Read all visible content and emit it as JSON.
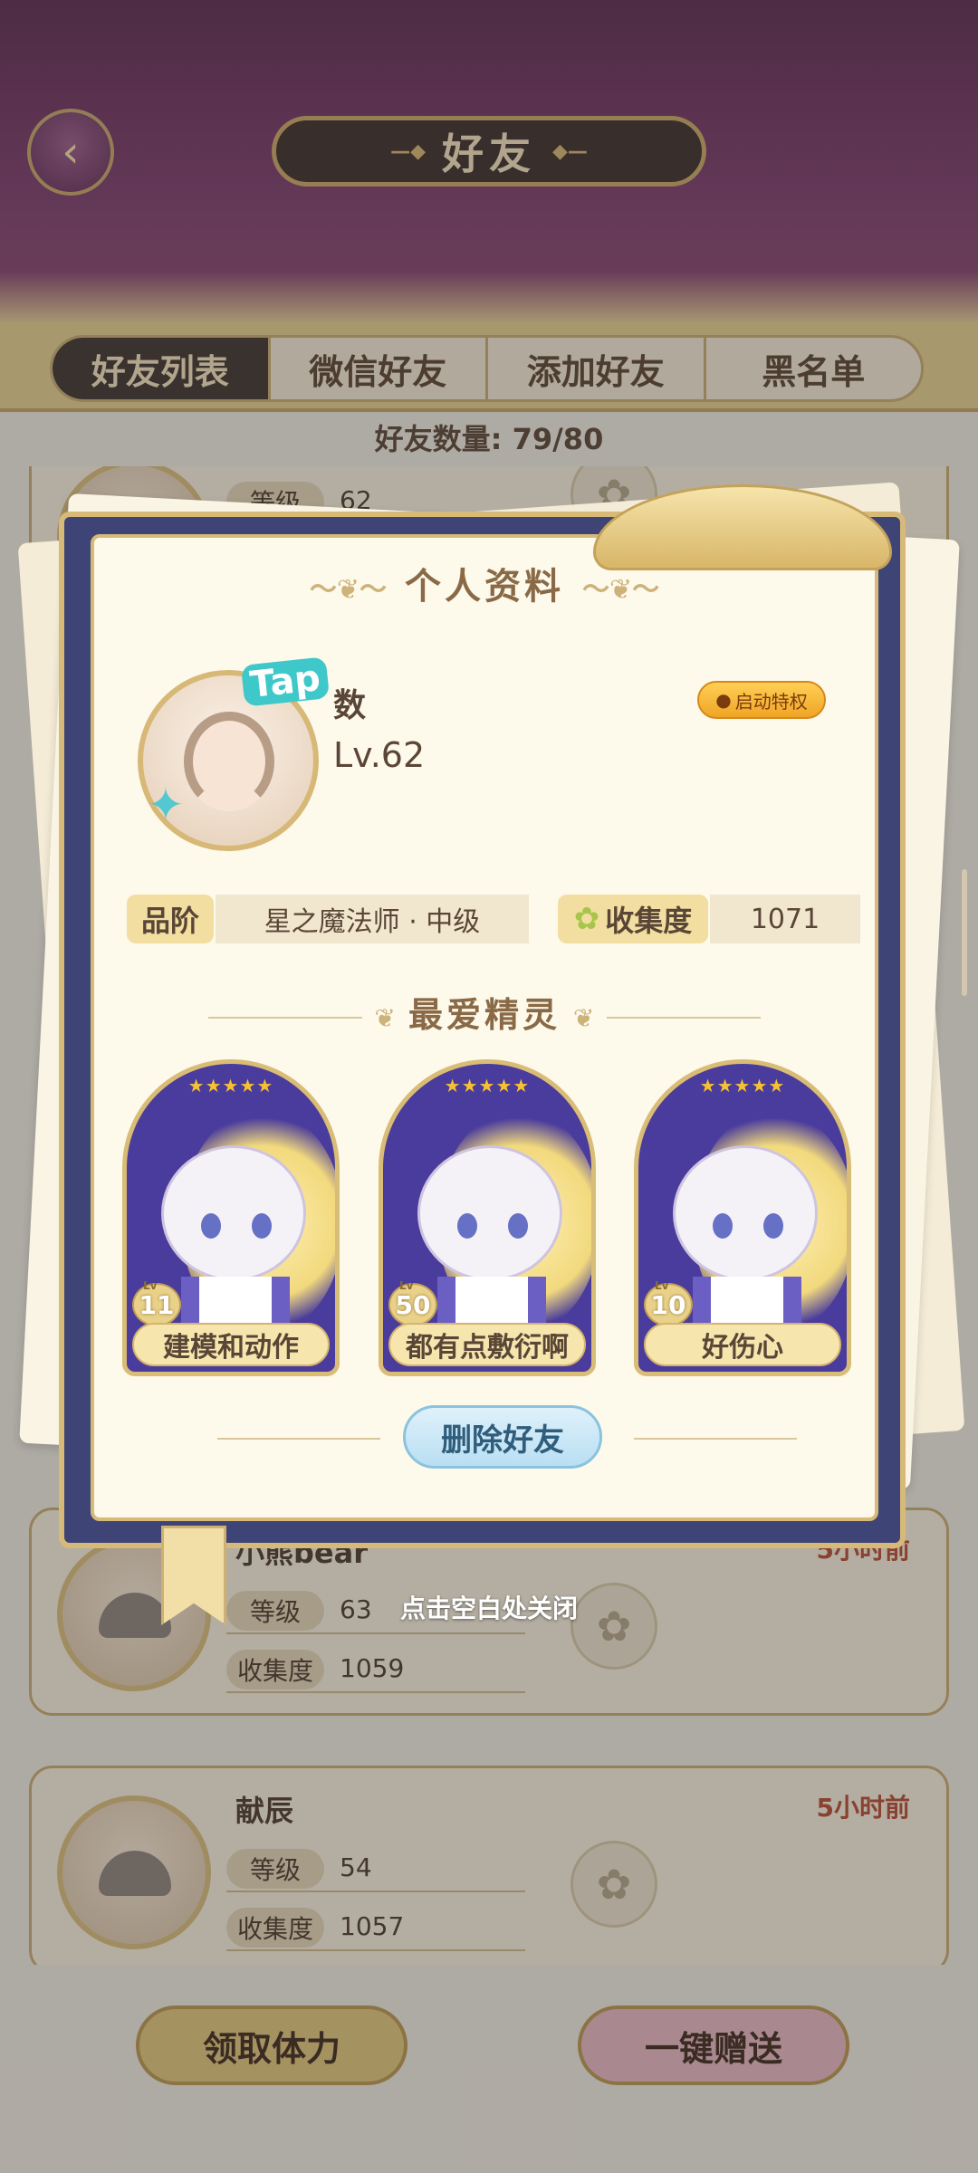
{
  "header": {
    "title": "好友",
    "back_icon": "back-arrow-icon"
  },
  "tabs": [
    {
      "label": "好友列表",
      "active": true
    },
    {
      "label": "微信好友",
      "active": false
    },
    {
      "label": "添加好友",
      "active": false
    },
    {
      "label": "黑名单",
      "active": false
    }
  ],
  "friend_count": "好友数量: 79/80",
  "friends": [
    {
      "name": "",
      "time": "",
      "level_label": "等级",
      "level": "62",
      "collection_label": "收集度",
      "collection": ""
    },
    {
      "name": "小熊bear",
      "time": "5小时前",
      "level_label": "等级",
      "level": "63",
      "collection_label": "收集度",
      "collection": "1059"
    },
    {
      "name": "献辰",
      "time": "5小时前",
      "level_label": "等级",
      "level": "54",
      "collection_label": "收集度",
      "collection": "1057"
    }
  ],
  "modal": {
    "title": "个人资料",
    "tap_badge": "Tap",
    "name": "数",
    "level": "Lv.62",
    "privilege_button": "启动特权",
    "rank_label": "品阶",
    "rank_value": "星之魔法师 · 中级",
    "collection_label": "收集度",
    "collection_value": "1071",
    "favorite_title": "最爱精灵",
    "pets": [
      {
        "name": "建模和动作",
        "level": "11",
        "stars": "★★★★★"
      },
      {
        "name": "都有点敷衍啊",
        "level": "50",
        "stars": "★★★★★"
      },
      {
        "name": "好伤心",
        "level": "10",
        "stars": "★★★★★"
      }
    ],
    "level_prefix": "Lv",
    "delete_button": "删除好友"
  },
  "close_hint": "点击空白处关闭",
  "bottom": {
    "claim_button": "领取体力",
    "send_all_button": "一键赠送"
  },
  "colors": {
    "active_tab": "#3c332f",
    "time_text": "#b64a32",
    "gold_border": "#d7ba78",
    "modal_frame": "#3f4477"
  }
}
